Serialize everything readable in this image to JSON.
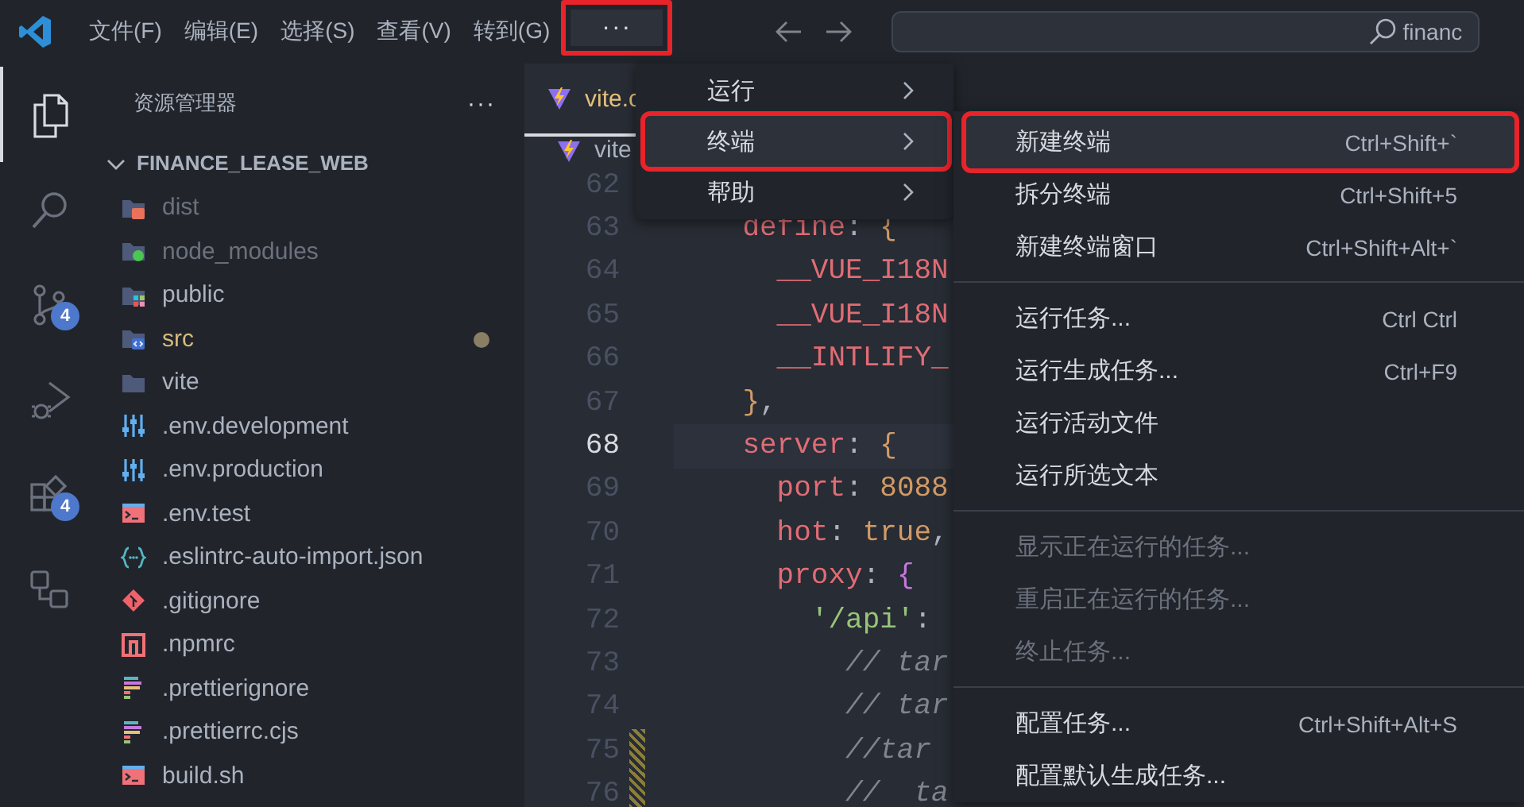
{
  "title_bar": {
    "menus": [
      {
        "label": "文件(F)"
      },
      {
        "label": "编辑(E)"
      },
      {
        "label": "选择(S)"
      },
      {
        "label": "查看(V)"
      },
      {
        "label": "转到(G)"
      }
    ],
    "more": {
      "label": "···",
      "selected": true,
      "annotated": true
    },
    "search": {
      "value": "financ"
    }
  },
  "activity_bar": {
    "items": [
      {
        "kind": "files",
        "selected": true
      },
      {
        "kind": "search",
        "selected": false
      },
      {
        "kind": "source-control",
        "selected": false,
        "badge": "4"
      },
      {
        "kind": "run-debug",
        "selected": false
      },
      {
        "kind": "extensions",
        "selected": false,
        "badge": "4"
      },
      {
        "kind": "remote",
        "selected": false
      }
    ]
  },
  "explorer": {
    "title": "资源管理器",
    "more": "···",
    "section": {
      "label": "FINANCE_LEASE_WEB",
      "expanded": true
    },
    "items": [
      {
        "name": "dist",
        "kind": "folder-dist",
        "ignored": true,
        "modified": false
      },
      {
        "name": "node_modules",
        "kind": "folder-node",
        "ignored": true,
        "modified": false
      },
      {
        "name": "public",
        "kind": "folder-public",
        "ignored": false,
        "modified": false
      },
      {
        "name": "src",
        "kind": "folder-src",
        "ignored": false,
        "modified": true
      },
      {
        "name": "vite",
        "kind": "folder",
        "ignored": false,
        "modified": false
      },
      {
        "name": ".env.development",
        "kind": "env",
        "ignored": false,
        "modified": false
      },
      {
        "name": ".env.production",
        "kind": "env",
        "ignored": false,
        "modified": false
      },
      {
        "name": ".env.test",
        "kind": "terminal",
        "ignored": false,
        "modified": false
      },
      {
        "name": ".eslintrc-auto-import.json",
        "kind": "json",
        "ignored": false,
        "modified": false
      },
      {
        "name": ".gitignore",
        "kind": "git",
        "ignored": false,
        "modified": false
      },
      {
        "name": ".npmrc",
        "kind": "npm",
        "ignored": false,
        "modified": false
      },
      {
        "name": ".prettierignore",
        "kind": "prettier",
        "ignored": false,
        "modified": false
      },
      {
        "name": ".prettierrc.cjs",
        "kind": "prettier",
        "ignored": false,
        "modified": false
      },
      {
        "name": "build.sh",
        "kind": "terminal",
        "ignored": false,
        "modified": false
      }
    ]
  },
  "editor": {
    "tab": {
      "label": "vite.c"
    },
    "breadcrumb": "vite",
    "lines": [
      {
        "number": "62",
        "current": false,
        "changed": false
      },
      {
        "number": "63",
        "current": false,
        "changed": false,
        "tokens": [
          {
            "text": "    define",
            "kind": "property"
          },
          {
            "text": ": ",
            "kind": "punctuation"
          },
          {
            "text": "{",
            "kind": "brace"
          }
        ]
      },
      {
        "number": "64",
        "current": false,
        "changed": false,
        "tokens": [
          {
            "text": "      __VUE_I18N",
            "kind": "property"
          }
        ]
      },
      {
        "number": "65",
        "current": false,
        "changed": false,
        "tokens": [
          {
            "text": "      __VUE_I18N",
            "kind": "property"
          }
        ]
      },
      {
        "number": "66",
        "current": false,
        "changed": false,
        "tokens": [
          {
            "text": "      __INTLIFY_",
            "kind": "property"
          }
        ]
      },
      {
        "number": "67",
        "current": false,
        "changed": false,
        "tokens": [
          {
            "text": "    }",
            "kind": "brace"
          },
          {
            "text": ",",
            "kind": "punctuation"
          }
        ]
      },
      {
        "number": "68",
        "current": true,
        "changed": false,
        "tokens": [
          {
            "text": "    server",
            "kind": "property"
          },
          {
            "text": ": ",
            "kind": "punctuation"
          },
          {
            "text": "{",
            "kind": "brace"
          }
        ]
      },
      {
        "number": "69",
        "current": false,
        "changed": false,
        "tokens": [
          {
            "text": "      port",
            "kind": "property"
          },
          {
            "text": ": ",
            "kind": "punctuation"
          },
          {
            "text": "8088",
            "kind": "number"
          }
        ]
      },
      {
        "number": "70",
        "current": false,
        "changed": false,
        "tokens": [
          {
            "text": "      hot",
            "kind": "property"
          },
          {
            "text": ": ",
            "kind": "punctuation"
          },
          {
            "text": "true",
            "kind": "keyword"
          },
          {
            "text": ",",
            "kind": "punctuation"
          }
        ]
      },
      {
        "number": "71",
        "current": false,
        "changed": false,
        "tokens": [
          {
            "text": "      proxy",
            "kind": "property"
          },
          {
            "text": ": ",
            "kind": "punctuation"
          },
          {
            "text": "{",
            "kind": "brace-nested"
          }
        ]
      },
      {
        "number": "72",
        "current": false,
        "changed": false,
        "tokens": [
          {
            "text": "        '/api'",
            "kind": "string"
          },
          {
            "text": ":",
            "kind": "punctuation"
          }
        ]
      },
      {
        "number": "73",
        "current": false,
        "changed": false,
        "tokens": [
          {
            "text": "          // tar",
            "kind": "comment"
          }
        ]
      },
      {
        "number": "74",
        "current": false,
        "changed": false,
        "tokens": [
          {
            "text": "          // tar",
            "kind": "comment"
          }
        ]
      },
      {
        "number": "75",
        "current": false,
        "changed": true,
        "tokens": [
          {
            "text": "          //tar",
            "kind": "comment"
          }
        ]
      },
      {
        "number": "76",
        "current": false,
        "changed": true,
        "tokens": [
          {
            "text": "          //  ta",
            "kind": "comment"
          }
        ]
      }
    ]
  },
  "menu": {
    "items": [
      {
        "label": "运行",
        "selected": false,
        "annotated": false
      },
      {
        "label": "终端",
        "selected": true,
        "annotated": true
      },
      {
        "label": "帮助",
        "selected": false,
        "annotated": false
      }
    ]
  },
  "submenu": {
    "groups": [
      {
        "items": [
          {
            "label": "新建终端",
            "shortcut": "Ctrl+Shift+`",
            "selected": true,
            "disabled": false,
            "annotated": true
          },
          {
            "label": "拆分终端",
            "shortcut": "Ctrl+Shift+5",
            "selected": false,
            "disabled": false,
            "annotated": false
          },
          {
            "label": "新建终端窗口",
            "shortcut": "Ctrl+Shift+Alt+`",
            "selected": false,
            "disabled": false,
            "annotated": false
          }
        ]
      },
      {
        "items": [
          {
            "label": "运行任务...",
            "shortcut": "Ctrl Ctrl",
            "selected": false,
            "disabled": false,
            "annotated": false
          },
          {
            "label": "运行生成任务...",
            "shortcut": "Ctrl+F9",
            "selected": false,
            "disabled": false,
            "annotated": false
          },
          {
            "label": "运行活动文件",
            "selected": false,
            "disabled": false,
            "annotated": false
          },
          {
            "label": "运行所选文本",
            "selected": false,
            "disabled": false,
            "annotated": false
          }
        ]
      },
      {
        "items": [
          {
            "label": "显示正在运行的任务...",
            "selected": false,
            "disabled": true,
            "annotated": false
          },
          {
            "label": "重启正在运行的任务...",
            "selected": false,
            "disabled": true,
            "annotated": false
          },
          {
            "label": "终止任务...",
            "selected": false,
            "disabled": true,
            "annotated": false
          }
        ]
      },
      {
        "items": [
          {
            "label": "配置任务...",
            "shortcut": "Ctrl+Shift+Alt+S",
            "selected": false,
            "disabled": false,
            "annotated": false
          },
          {
            "label": "配置默认生成任务...",
            "selected": false,
            "disabled": false,
            "annotated": false
          }
        ]
      }
    ]
  }
}
